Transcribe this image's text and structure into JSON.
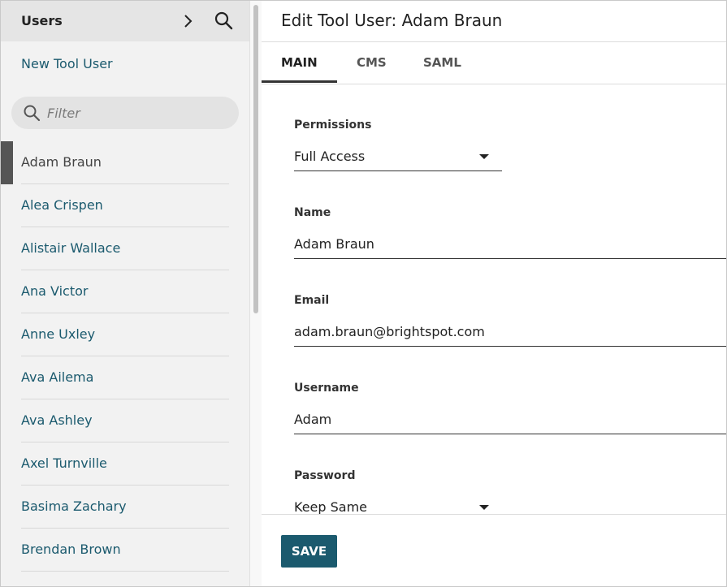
{
  "sidebar": {
    "title": "Users",
    "new_link": "New Tool User",
    "filter_placeholder": "Filter",
    "users": [
      "Adam Braun",
      "Alea Crispen",
      "Alistair Wallace",
      "Ana Victor",
      "Anne Uxley",
      "Ava Ailema",
      "Ava Ashley",
      "Axel Turnville",
      "Basima Zachary",
      "Brendan Brown"
    ],
    "active_user": "Adam Braun",
    "icons": {
      "expand": "chevron-right-icon",
      "search": "search-icon",
      "filter": "search-icon"
    }
  },
  "main": {
    "title": "Edit Tool User: Adam Braun",
    "tabs": [
      "MAIN",
      "CMS",
      "SAML"
    ],
    "active_tab": "MAIN",
    "fields": {
      "permissions": {
        "label": "Permissions",
        "value": "Full Access"
      },
      "name": {
        "label": "Name",
        "value": "Adam Braun"
      },
      "email": {
        "label": "Email",
        "value": "adam.braun@brightspot.com"
      },
      "username": {
        "label": "Username",
        "value": "Adam"
      },
      "password": {
        "label": "Password",
        "value": "Keep Same"
      }
    },
    "save_label": "SAVE"
  },
  "colors": {
    "accent": "#1b5a6e",
    "sidebar_bg": "#f2f2f2",
    "sidebar_header_bg": "#e5e5e5",
    "active_marker": "#555555"
  }
}
